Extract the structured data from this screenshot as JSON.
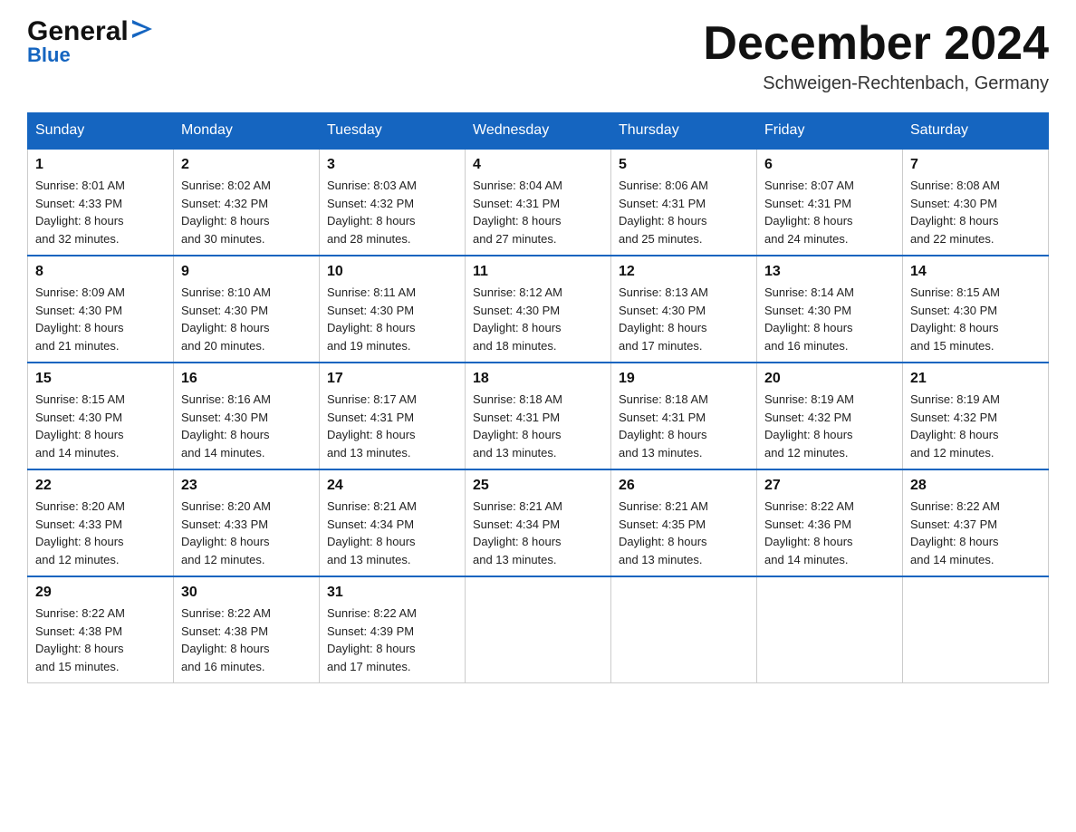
{
  "header": {
    "logo_general": "General",
    "logo_blue": "Blue",
    "month_title": "December 2024",
    "location": "Schweigen-Rechtenbach, Germany"
  },
  "days_of_week": [
    "Sunday",
    "Monday",
    "Tuesday",
    "Wednesday",
    "Thursday",
    "Friday",
    "Saturday"
  ],
  "weeks": [
    [
      {
        "day": "1",
        "sunrise": "8:01 AM",
        "sunset": "4:33 PM",
        "daylight": "8 hours and 32 minutes."
      },
      {
        "day": "2",
        "sunrise": "8:02 AM",
        "sunset": "4:32 PM",
        "daylight": "8 hours and 30 minutes."
      },
      {
        "day": "3",
        "sunrise": "8:03 AM",
        "sunset": "4:32 PM",
        "daylight": "8 hours and 28 minutes."
      },
      {
        "day": "4",
        "sunrise": "8:04 AM",
        "sunset": "4:31 PM",
        "daylight": "8 hours and 27 minutes."
      },
      {
        "day": "5",
        "sunrise": "8:06 AM",
        "sunset": "4:31 PM",
        "daylight": "8 hours and 25 minutes."
      },
      {
        "day": "6",
        "sunrise": "8:07 AM",
        "sunset": "4:31 PM",
        "daylight": "8 hours and 24 minutes."
      },
      {
        "day": "7",
        "sunrise": "8:08 AM",
        "sunset": "4:30 PM",
        "daylight": "8 hours and 22 minutes."
      }
    ],
    [
      {
        "day": "8",
        "sunrise": "8:09 AM",
        "sunset": "4:30 PM",
        "daylight": "8 hours and 21 minutes."
      },
      {
        "day": "9",
        "sunrise": "8:10 AM",
        "sunset": "4:30 PM",
        "daylight": "8 hours and 20 minutes."
      },
      {
        "day": "10",
        "sunrise": "8:11 AM",
        "sunset": "4:30 PM",
        "daylight": "8 hours and 19 minutes."
      },
      {
        "day": "11",
        "sunrise": "8:12 AM",
        "sunset": "4:30 PM",
        "daylight": "8 hours and 18 minutes."
      },
      {
        "day": "12",
        "sunrise": "8:13 AM",
        "sunset": "4:30 PM",
        "daylight": "8 hours and 17 minutes."
      },
      {
        "day": "13",
        "sunrise": "8:14 AM",
        "sunset": "4:30 PM",
        "daylight": "8 hours and 16 minutes."
      },
      {
        "day": "14",
        "sunrise": "8:15 AM",
        "sunset": "4:30 PM",
        "daylight": "8 hours and 15 minutes."
      }
    ],
    [
      {
        "day": "15",
        "sunrise": "8:15 AM",
        "sunset": "4:30 PM",
        "daylight": "8 hours and 14 minutes."
      },
      {
        "day": "16",
        "sunrise": "8:16 AM",
        "sunset": "4:30 PM",
        "daylight": "8 hours and 14 minutes."
      },
      {
        "day": "17",
        "sunrise": "8:17 AM",
        "sunset": "4:31 PM",
        "daylight": "8 hours and 13 minutes."
      },
      {
        "day": "18",
        "sunrise": "8:18 AM",
        "sunset": "4:31 PM",
        "daylight": "8 hours and 13 minutes."
      },
      {
        "day": "19",
        "sunrise": "8:18 AM",
        "sunset": "4:31 PM",
        "daylight": "8 hours and 13 minutes."
      },
      {
        "day": "20",
        "sunrise": "8:19 AM",
        "sunset": "4:32 PM",
        "daylight": "8 hours and 12 minutes."
      },
      {
        "day": "21",
        "sunrise": "8:19 AM",
        "sunset": "4:32 PM",
        "daylight": "8 hours and 12 minutes."
      }
    ],
    [
      {
        "day": "22",
        "sunrise": "8:20 AM",
        "sunset": "4:33 PM",
        "daylight": "8 hours and 12 minutes."
      },
      {
        "day": "23",
        "sunrise": "8:20 AM",
        "sunset": "4:33 PM",
        "daylight": "8 hours and 12 minutes."
      },
      {
        "day": "24",
        "sunrise": "8:21 AM",
        "sunset": "4:34 PM",
        "daylight": "8 hours and 13 minutes."
      },
      {
        "day": "25",
        "sunrise": "8:21 AM",
        "sunset": "4:34 PM",
        "daylight": "8 hours and 13 minutes."
      },
      {
        "day": "26",
        "sunrise": "8:21 AM",
        "sunset": "4:35 PM",
        "daylight": "8 hours and 13 minutes."
      },
      {
        "day": "27",
        "sunrise": "8:22 AM",
        "sunset": "4:36 PM",
        "daylight": "8 hours and 14 minutes."
      },
      {
        "day": "28",
        "sunrise": "8:22 AM",
        "sunset": "4:37 PM",
        "daylight": "8 hours and 14 minutes."
      }
    ],
    [
      {
        "day": "29",
        "sunrise": "8:22 AM",
        "sunset": "4:38 PM",
        "daylight": "8 hours and 15 minutes."
      },
      {
        "day": "30",
        "sunrise": "8:22 AM",
        "sunset": "4:38 PM",
        "daylight": "8 hours and 16 minutes."
      },
      {
        "day": "31",
        "sunrise": "8:22 AM",
        "sunset": "4:39 PM",
        "daylight": "8 hours and 17 minutes."
      },
      null,
      null,
      null,
      null
    ]
  ],
  "labels": {
    "sunrise_prefix": "Sunrise: ",
    "sunset_prefix": "Sunset: ",
    "daylight_prefix": "Daylight: "
  }
}
